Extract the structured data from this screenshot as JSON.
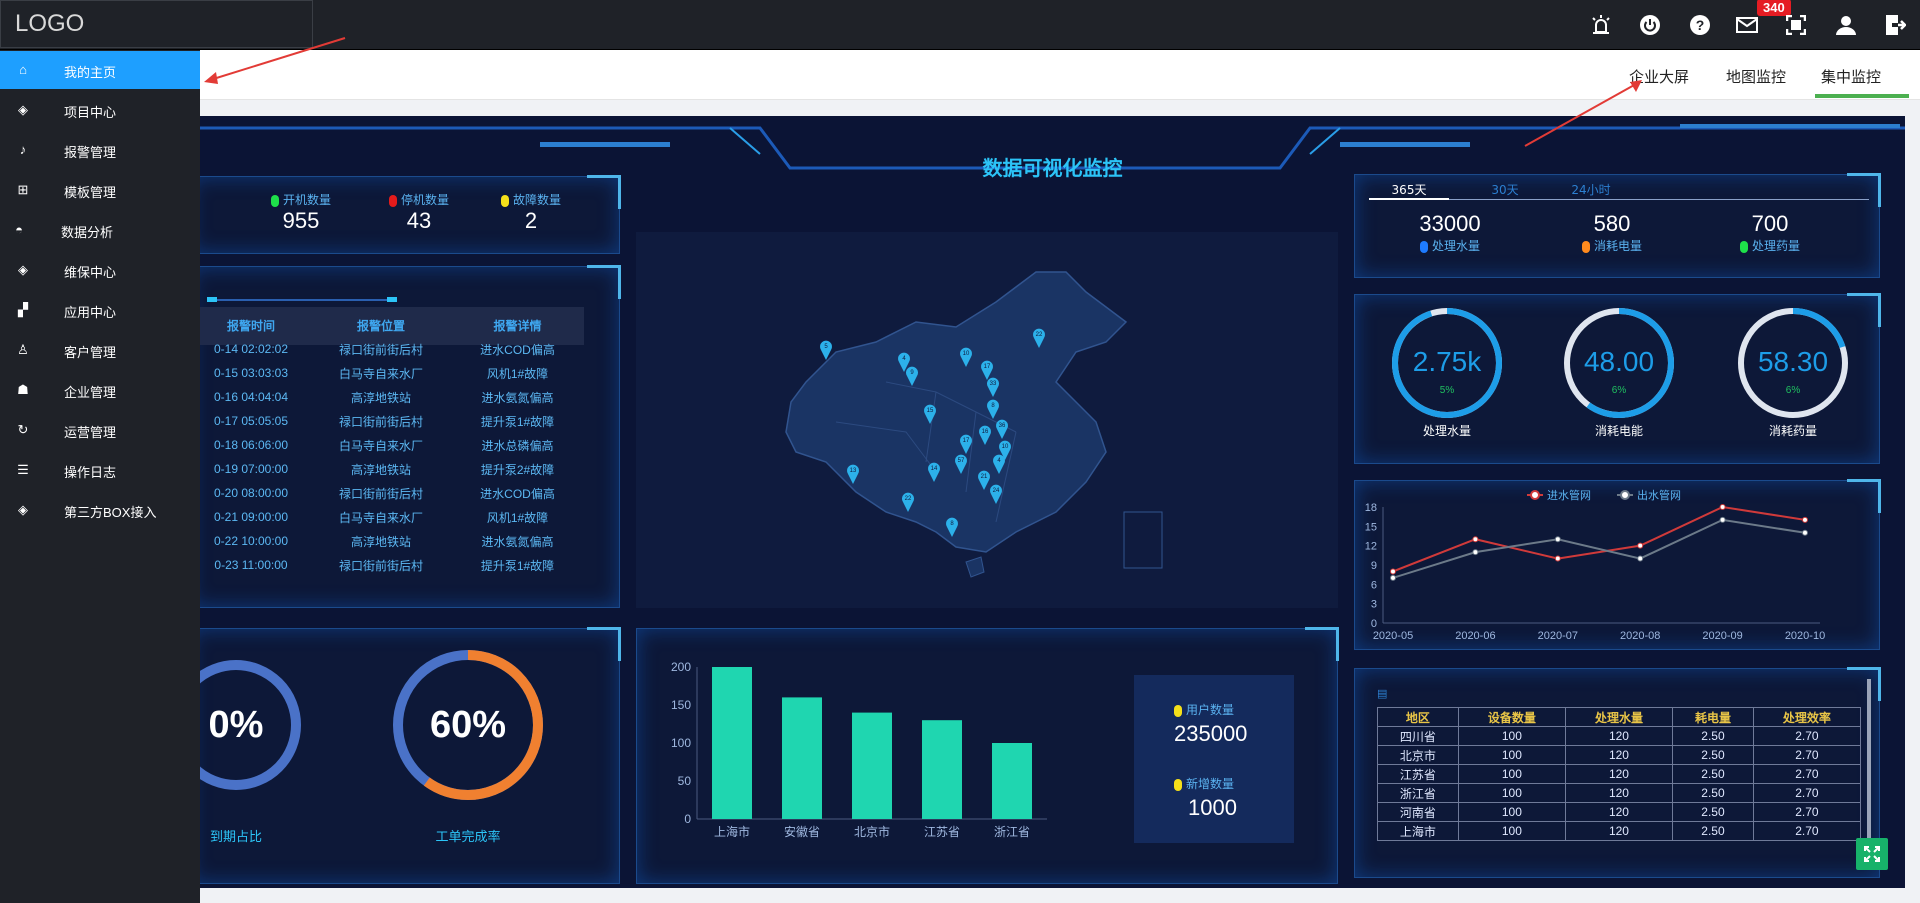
{
  "topbar": {
    "logo": "LOGO",
    "badge": "340",
    "icons": [
      "alarm-icon",
      "power-icon",
      "help-icon",
      "mail-icon",
      "fullscreen-icon",
      "user-icon",
      "logout-icon"
    ]
  },
  "tabs": [
    {
      "label": "企业大屏",
      "active": true
    },
    {
      "label": "地图监控"
    },
    {
      "label": "集中监控"
    }
  ],
  "sidebar": {
    "items": [
      {
        "label": "我的主页",
        "icon": "home-icon",
        "active": true
      },
      {
        "label": "项目中心",
        "icon": "layers-icon"
      },
      {
        "label": "报警管理",
        "icon": "bell-icon"
      },
      {
        "label": "模板管理",
        "icon": "template-icon"
      },
      {
        "label": "数据分析",
        "icon": "gauge-icon"
      },
      {
        "label": "维保中心",
        "icon": "layers-icon"
      },
      {
        "label": "应用中心",
        "icon": "grid-icon"
      },
      {
        "label": "客户管理",
        "icon": "user-icon"
      },
      {
        "label": "企业管理",
        "icon": "enterprise-icon"
      },
      {
        "label": "运营管理",
        "icon": "cycle-icon"
      },
      {
        "label": "操作日志",
        "icon": "log-icon"
      },
      {
        "label": "第三方BOX接入",
        "icon": "layers-icon"
      }
    ]
  },
  "dashboard": {
    "title": "数据可视化监控",
    "status": [
      {
        "label": "开机数量",
        "value": "955",
        "color": "#1ee04a"
      },
      {
        "label": "停机数量",
        "value": "43",
        "color": "#e41b1b"
      },
      {
        "label": "故障数量",
        "value": "2",
        "color": "#f5e01a"
      }
    ],
    "alarm_table": {
      "headers": [
        "报警时间",
        "报警位置",
        "报警详情"
      ],
      "rows": [
        [
          "0-14 02:02:02",
          "禄口街前街后村",
          "进水COD偏高"
        ],
        [
          "0-15 03:03:03",
          "白马寺自来水厂",
          "风机1#故障"
        ],
        [
          "0-16 04:04:04",
          "高淳地铁站",
          "进水氨氮偏高"
        ],
        [
          "0-17 05:05:05",
          "禄口街前街后村",
          "提升泵1#故障"
        ],
        [
          "0-18 06:06:00",
          "白马寺自来水厂",
          "进水总磷偏高"
        ],
        [
          "0-19 07:00:00",
          "高淳地铁站",
          "提升泵2#故障"
        ],
        [
          "0-20 08:00:00",
          "禄口街前街后村",
          "进水COD偏高"
        ],
        [
          "0-21 09:00:00",
          "白马寺自来水厂",
          "风机1#故障"
        ],
        [
          "0-22 10:00:00",
          "高淳地铁站",
          "进水氨氮偏高"
        ],
        [
          "0-23 11:00:00",
          "禄口街前街后村",
          "提升泵1#故障"
        ]
      ]
    },
    "rings": [
      {
        "value": "0%",
        "label": "到期占比",
        "fraction": 0.0
      },
      {
        "value": "60%",
        "label": "工单完成率",
        "fraction": 0.6
      }
    ],
    "period_tabs": [
      "365天",
      "30天",
      "24小时"
    ],
    "totals": [
      {
        "value": "33000",
        "label": "处理水量",
        "color": "#1e7bff"
      },
      {
        "value": "580",
        "label": "消耗电量",
        "color": "#ff8a1e"
      },
      {
        "value": "700",
        "label": "处理药量",
        "color": "#1ee04a"
      }
    ],
    "gauges": [
      {
        "value": "2.75k",
        "pct": "5%",
        "label": "处理水量",
        "fraction": 0.95
      },
      {
        "value": "48.00",
        "pct": "6%",
        "label": "消耗电能",
        "fraction": 0.6
      },
      {
        "value": "58.30",
        "pct": "6%",
        "label": "消耗药量",
        "fraction": 0.2
      }
    ],
    "users": [
      {
        "label": "用户数量",
        "value": "235000"
      },
      {
        "label": "新增数量",
        "value": "1000"
      }
    ],
    "table": {
      "headers": [
        "地区",
        "设备数量",
        "处理水量",
        "耗电量",
        "处理效率"
      ],
      "rows": [
        [
          "四川省",
          "100",
          "120",
          "2.50",
          "2.70"
        ],
        [
          "北京市",
          "100",
          "120",
          "2.50",
          "2.70"
        ],
        [
          "江苏省",
          "100",
          "120",
          "2.50",
          "2.70"
        ],
        [
          "浙江省",
          "100",
          "120",
          "2.50",
          "2.70"
        ],
        [
          "河南省",
          "100",
          "120",
          "2.50",
          "2.70"
        ],
        [
          "上海市",
          "100",
          "120",
          "2.50",
          "2.70"
        ]
      ]
    },
    "map_pins": [
      "5",
      "4",
      "9",
      "15",
      "10",
      "17",
      "33",
      "8",
      "17",
      "16",
      "36",
      "10",
      "4",
      "22",
      "14",
      "57",
      "21",
      "24",
      "13",
      "22",
      "8"
    ]
  },
  "chart_data": [
    {
      "type": "bar",
      "categories": [
        "上海市",
        "安徽省",
        "北京市",
        "江苏省",
        "浙江省"
      ],
      "values": [
        200,
        160,
        140,
        130,
        100
      ],
      "ylim": [
        0,
        200
      ],
      "yticks": [
        0,
        50,
        100,
        150,
        200
      ],
      "color": "#1fd6b0"
    },
    {
      "type": "line",
      "categories": [
        "2020-05",
        "2020-06",
        "2020-07",
        "2020-08",
        "2020-09",
        "2020-10"
      ],
      "series": [
        {
          "name": "进水管网",
          "values": [
            8,
            13,
            10,
            12,
            18,
            16
          ],
          "color": "#d03a3a"
        },
        {
          "name": "出水管网",
          "values": [
            7,
            11,
            13,
            10,
            16,
            14
          ],
          "color": "#6c7a89"
        }
      ],
      "ylim": [
        0,
        18
      ],
      "yticks": [
        0,
        3,
        6,
        9,
        12,
        15,
        18
      ]
    }
  ]
}
